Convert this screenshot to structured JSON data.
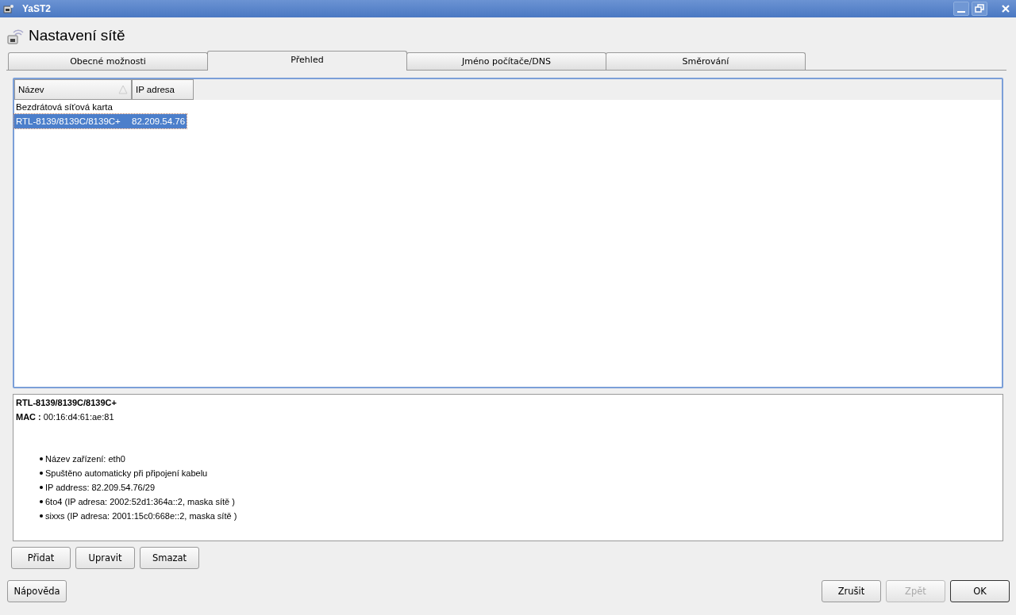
{
  "window": {
    "title": "YaST2"
  },
  "header": {
    "title": "Nastavení sítě"
  },
  "tabs": [
    {
      "label": "Obecné možnosti",
      "selected": false
    },
    {
      "label": "Přehled",
      "selected": true
    },
    {
      "label": "Jméno počítače/DNS",
      "selected": false
    },
    {
      "label": "Směrování",
      "selected": false
    }
  ],
  "table": {
    "columns": [
      {
        "label": "Název",
        "sorted": true
      },
      {
        "label": "IP adresa",
        "sorted": false
      }
    ],
    "rows": [
      {
        "cells": [
          "Bezdrátová síťová karta",
          ""
        ],
        "selected": false
      },
      {
        "cells": [
          "RTL-8139/8139C/8139C+",
          "82.209.54.76"
        ],
        "selected": true
      }
    ]
  },
  "details": {
    "title": "RTL-8139/8139C/8139C+",
    "mac": "**MAC :** 00:16:d4:61:ae:81",
    "items": [
      "Název zařízení: eth0",
      "Spuštěno automaticky při připojení kabelu",
      "IP address: 82.209.54.76/29",
      "6to4 (IP adresa: 2002:52d1:364a::2, maska sítě )",
      "sixxs (IP adresa: 2001:15c0:668e::2, maska sítě )"
    ]
  },
  "actions": [
    {
      "label": "Přidat",
      "disabled": false
    },
    {
      "label": "Upravit",
      "disabled": false
    },
    {
      "label": "Smazat",
      "disabled": false
    }
  ],
  "footer": {
    "help": {
      "label": "Nápověda",
      "disabled": false
    },
    "buttons": [
      {
        "label": "Zrušit",
        "disabled": false,
        "kind": "normal"
      },
      {
        "label": "Zpět",
        "disabled": true,
        "kind": "normal"
      },
      {
        "label": "OK",
        "disabled": false,
        "kind": "default"
      }
    ]
  }
}
